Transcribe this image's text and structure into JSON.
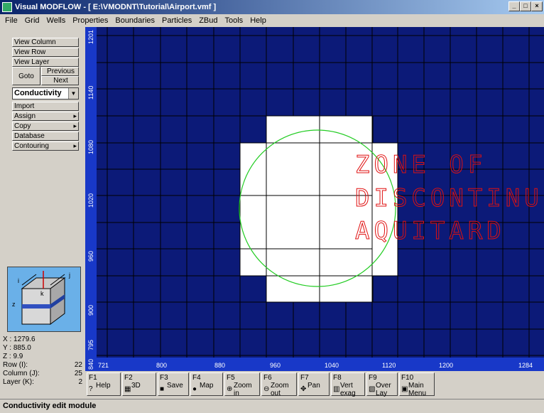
{
  "window": {
    "title": "Visual MODFLOW - [ E:\\VMODNT\\Tutorial\\Airport.vmf ]",
    "minimize": "_",
    "maximize": "□",
    "close": "×"
  },
  "menu": [
    "File",
    "Grid",
    "Wells",
    "Properties",
    "Boundaries",
    "Particles",
    "ZBud",
    "Tools",
    "Help"
  ],
  "left": {
    "view_column": "View Column",
    "view_row": "View Row",
    "view_layer": "View Layer",
    "goto": "Goto",
    "previous": "Previous",
    "next": "Next",
    "property": "Conductivity",
    "import": "Import",
    "assign": "Assign",
    "copy": "Copy",
    "database": "Database",
    "contouring": "Contouring"
  },
  "coords": {
    "x": "X : 1279.6",
    "y": "Y : 885.0",
    "z": "Z : 9.9",
    "row_label": "Row    (I):",
    "row_val": "22",
    "col_label": "Column (J):",
    "col_val": "25",
    "lay_label": "Layer  (K):",
    "lay_val": "2"
  },
  "map": {
    "x_ticks": [
      "721",
      "800",
      "880",
      "960",
      "1040",
      "1120",
      "1200",
      "1284"
    ],
    "y_ticks": [
      "1201",
      "1140",
      "1080",
      "1020",
      "960",
      "900",
      "840",
      "795"
    ],
    "zone_text": [
      "ZONE OF",
      "DISCONTINU",
      "AQUITARD"
    ],
    "colors": {
      "background": "#0c1a78",
      "grid": "#000000",
      "zone": "#ffffff",
      "circle": "#22cc22",
      "text": "#e01010"
    }
  },
  "fkeys": [
    {
      "fn": "F1",
      "label": "Help",
      "icon": "help-icon"
    },
    {
      "fn": "F2",
      "label": "3D",
      "icon": "3d-icon"
    },
    {
      "fn": "F3",
      "label": "Save",
      "icon": "save-icon"
    },
    {
      "fn": "F4",
      "label": "Map",
      "icon": "map-icon"
    },
    {
      "fn": "F5",
      "label": "Zoom in",
      "icon": "zoom-in-icon"
    },
    {
      "fn": "F6",
      "label": "Zoom out",
      "icon": "zoom-out-icon"
    },
    {
      "fn": "F7",
      "label": "Pan",
      "icon": "pan-icon"
    },
    {
      "fn": "F8",
      "label": "Vert exag",
      "icon": "vert-exag-icon"
    },
    {
      "fn": "F9",
      "label": "Over Lay",
      "icon": "overlay-icon"
    },
    {
      "fn": "F10",
      "label": "Main Menu",
      "icon": "main-menu-icon"
    }
  ],
  "status": "Conductivity edit module"
}
